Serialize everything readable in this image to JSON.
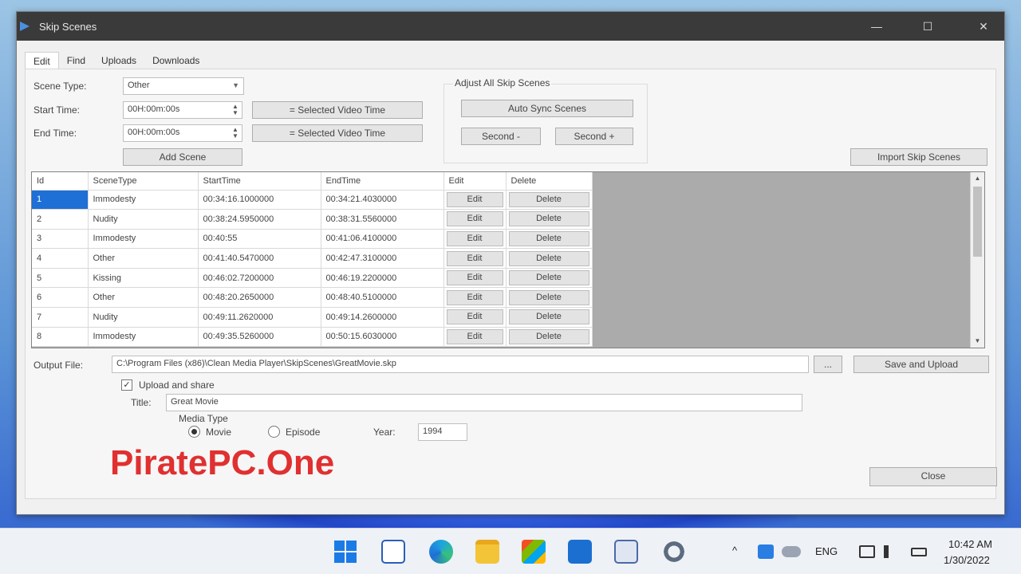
{
  "window": {
    "title": "Skip Scenes",
    "minimize": "—",
    "maximize": "☐",
    "close": "✕"
  },
  "tabs": [
    {
      "label": "Edit"
    },
    {
      "label": "Find"
    },
    {
      "label": "Uploads"
    },
    {
      "label": "Downloads"
    }
  ],
  "form": {
    "scene_type_label": "Scene Type:",
    "scene_type_value": "Other",
    "start_time_label": "Start Time:",
    "start_time_value": "00H:00m:00s",
    "end_time_label": "End Time:",
    "end_time_value": "00H:00m:00s",
    "selected_video_time_1": "= Selected Video Time",
    "selected_video_time_2": "= Selected Video Time",
    "add_scene": "Add Scene"
  },
  "adjust": {
    "title": "Adjust All Skip Scenes",
    "auto_sync": "Auto Sync Scenes",
    "second_minus": "Second -",
    "second_plus": "Second +"
  },
  "import_button": "Import Skip Scenes",
  "grid": {
    "headers": [
      "Id",
      "SceneType",
      "StartTime",
      "EndTime",
      "Edit",
      "Delete"
    ],
    "rows": [
      {
        "id": "1",
        "type": "Immodesty",
        "start": "00:34:16.1000000",
        "end": "00:34:21.4030000",
        "edit": "Edit",
        "delete": "Delete"
      },
      {
        "id": "2",
        "type": "Nudity",
        "start": "00:38:24.5950000",
        "end": "00:38:31.5560000",
        "edit": "Edit",
        "delete": "Delete"
      },
      {
        "id": "3",
        "type": "Immodesty",
        "start": "00:40:55",
        "end": "00:41:06.4100000",
        "edit": "Edit",
        "delete": "Delete"
      },
      {
        "id": "4",
        "type": "Other",
        "start": "00:41:40.5470000",
        "end": "00:42:47.3100000",
        "edit": "Edit",
        "delete": "Delete"
      },
      {
        "id": "5",
        "type": "Kissing",
        "start": "00:46:02.7200000",
        "end": "00:46:19.2200000",
        "edit": "Edit",
        "delete": "Delete"
      },
      {
        "id": "6",
        "type": "Other",
        "start": "00:48:20.2650000",
        "end": "00:48:40.5100000",
        "edit": "Edit",
        "delete": "Delete"
      },
      {
        "id": "7",
        "type": "Nudity",
        "start": "00:49:11.2620000",
        "end": "00:49:14.2600000",
        "edit": "Edit",
        "delete": "Delete"
      },
      {
        "id": "8",
        "type": "Immodesty",
        "start": "00:49:35.5260000",
        "end": "00:50:15.6030000",
        "edit": "Edit",
        "delete": "Delete"
      }
    ],
    "scroll_up": "▲",
    "scroll_down": "▼"
  },
  "output": {
    "label": "Output File:",
    "path": "C:\\Program Files (x86)\\Clean Media Player\\SkipScenes\\GreatMovie.skp",
    "browse": "...",
    "save_upload": "Save and Upload"
  },
  "upload": {
    "checkbox_label": "Upload and share",
    "checked_mark": "✓",
    "title_label": "Title:",
    "title_value": "Great Movie",
    "media_type_label": "Media Type",
    "movie_label": "Movie",
    "episode_label": "Episode",
    "year_label": "Year:",
    "year_value": "1994"
  },
  "close_button": "Close",
  "watermark": "PiratePC.One",
  "taskbar": {
    "language": "ENG",
    "time": "10:42 AM",
    "date": "1/30/2022",
    "chevron": "^"
  },
  "colors": {
    "selection": "#1e6fd6",
    "watermark": "#e03030",
    "titlebar": "#3a3a3a"
  }
}
